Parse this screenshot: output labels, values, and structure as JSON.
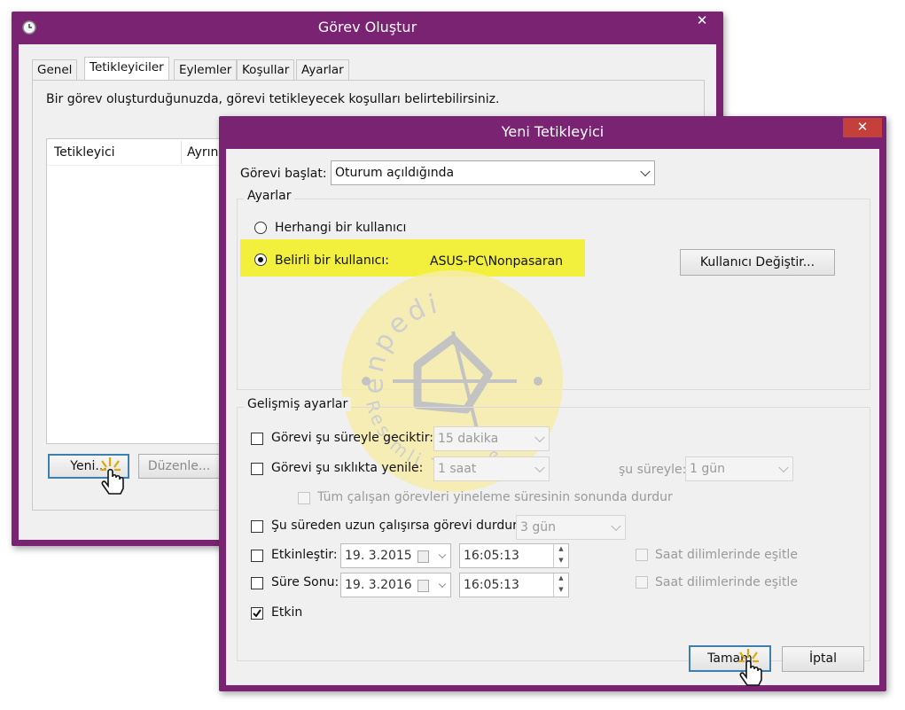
{
  "back_window": {
    "title": "Görev Oluştur",
    "close_label": "✕",
    "tabs": [
      "Genel",
      "Tetikleyiciler",
      "Eylemler",
      "Koşullar",
      "Ayarlar"
    ],
    "description": "Bir görev oluşturduğunuzda, görevi tetikleyecek koşulları belirtebilirsiniz.",
    "table_headers": [
      "Tetikleyici",
      "Ayrın"
    ],
    "buttons": {
      "new": "Yeni...",
      "edit": "Düzenle..."
    }
  },
  "front_window": {
    "title": "Yeni Tetikleyici",
    "close_label": "✕",
    "start_task_label": "Görevi başlat:",
    "start_task_value": "Oturum açıldığında",
    "settings_group": "Ayarlar",
    "radio_any_user": "Herhangi bir kullanıcı",
    "radio_specific_user": "Belirli bir kullanıcı:",
    "user_name": "ASUS-PC\\Nonpasaran",
    "change_user_button": "Kullanıcı Değiştir...",
    "advanced_group": "Gelişmiş ayarlar",
    "delay_label": "Görevi şu süreyle geciktir:",
    "delay_value": "15 dakika",
    "repeat_label": "Görevi şu sıklıkta yenile:",
    "repeat_value": "1 saat",
    "duration_label": "şu süreyle:",
    "duration_value": "1 gün",
    "stop_all_label": "Tüm çalışan görevleri yineleme süresinin sonunda durdur",
    "stop_long_label": "Şu süreden uzun çalışırsa görevi durdur:",
    "stop_long_value": "3 gün",
    "activate_label": "Etkinleştir:",
    "activate_date": "19.  3.2015",
    "activate_time": "16:05:13",
    "sync_tz_1": "Saat dilimlerinde eşitle",
    "expire_label": "Süre Sonu:",
    "expire_date": "19.  3.2016",
    "expire_time": "16:05:13",
    "sync_tz_2": "Saat dilimlerinde eşitle",
    "enabled_label": "Etkin",
    "enabled_checked": true,
    "ok_button": "Tamam",
    "cancel_button": "İptal"
  },
  "watermark": {
    "top_text": "enpedi",
    "bottom_text": "Resimli Türkçe"
  },
  "colors": {
    "frame": "#7a2372",
    "close_red": "#c5403a",
    "highlight": "#f2f03c",
    "default_button_border": "#3c7fb1"
  },
  "icons": [
    "clock-icon",
    "close-icon",
    "chevron-down-icon",
    "calendar-icon",
    "spin-up-icon",
    "spin-down-icon",
    "checkmark-icon",
    "hand-cursor-icon"
  ]
}
